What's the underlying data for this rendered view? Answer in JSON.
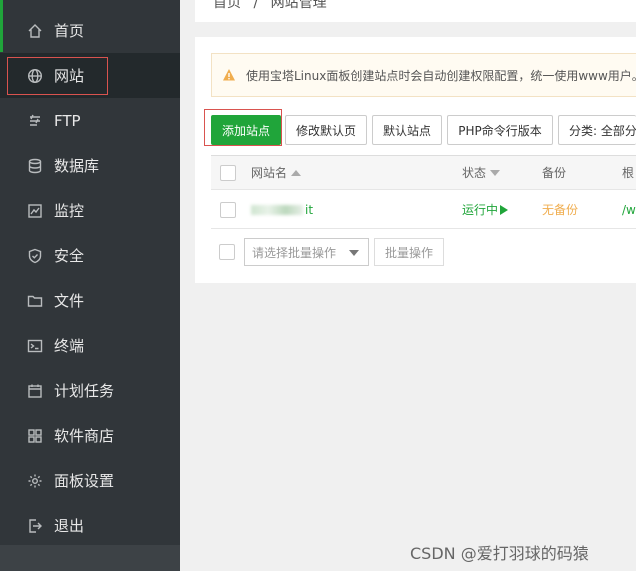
{
  "sidebar": {
    "items": [
      {
        "label": "首页",
        "icon": "home-icon"
      },
      {
        "label": "网站",
        "icon": "globe-icon",
        "active": true
      },
      {
        "label": "FTP",
        "icon": "ftp-icon"
      },
      {
        "label": "数据库",
        "icon": "database-icon"
      },
      {
        "label": "监控",
        "icon": "monitor-icon"
      },
      {
        "label": "安全",
        "icon": "shield-icon"
      },
      {
        "label": "文件",
        "icon": "folder-icon"
      },
      {
        "label": "终端",
        "icon": "terminal-icon"
      },
      {
        "label": "计划任务",
        "icon": "calendar-icon"
      },
      {
        "label": "软件商店",
        "icon": "apps-icon"
      },
      {
        "label": "面板设置",
        "icon": "gear-icon"
      },
      {
        "label": "退出",
        "icon": "logout-icon"
      }
    ]
  },
  "breadcrumb": {
    "home": "首页",
    "sep": "/",
    "current": "网站管理"
  },
  "alert": {
    "text": "使用宝塔Linux面板创建站点时会自动创建权限配置，统一使用www用户。"
  },
  "toolbar": {
    "add_site": "添加站点",
    "edit_default_page": "修改默认页",
    "default_site": "默认站点",
    "php_cli_version": "PHP命令行版本",
    "category": "分类: 全部分"
  },
  "table": {
    "headers": {
      "name": "网站名",
      "status": "状态",
      "backup": "备份",
      "root": "根"
    },
    "rows": [
      {
        "name_suffix": "it",
        "status": "运行中",
        "backup": "无备份",
        "root": "/w"
      }
    ]
  },
  "batch": {
    "select_placeholder": "请选择批量操作",
    "button": "批量操作"
  },
  "watermark": "CSDN @爱打羽球的码猿",
  "colors": {
    "sidebar_bg": "#31363a",
    "accent_green": "#20a53a",
    "backup_orange": "#f0ad4e",
    "highlight_red": "#d9534f"
  }
}
